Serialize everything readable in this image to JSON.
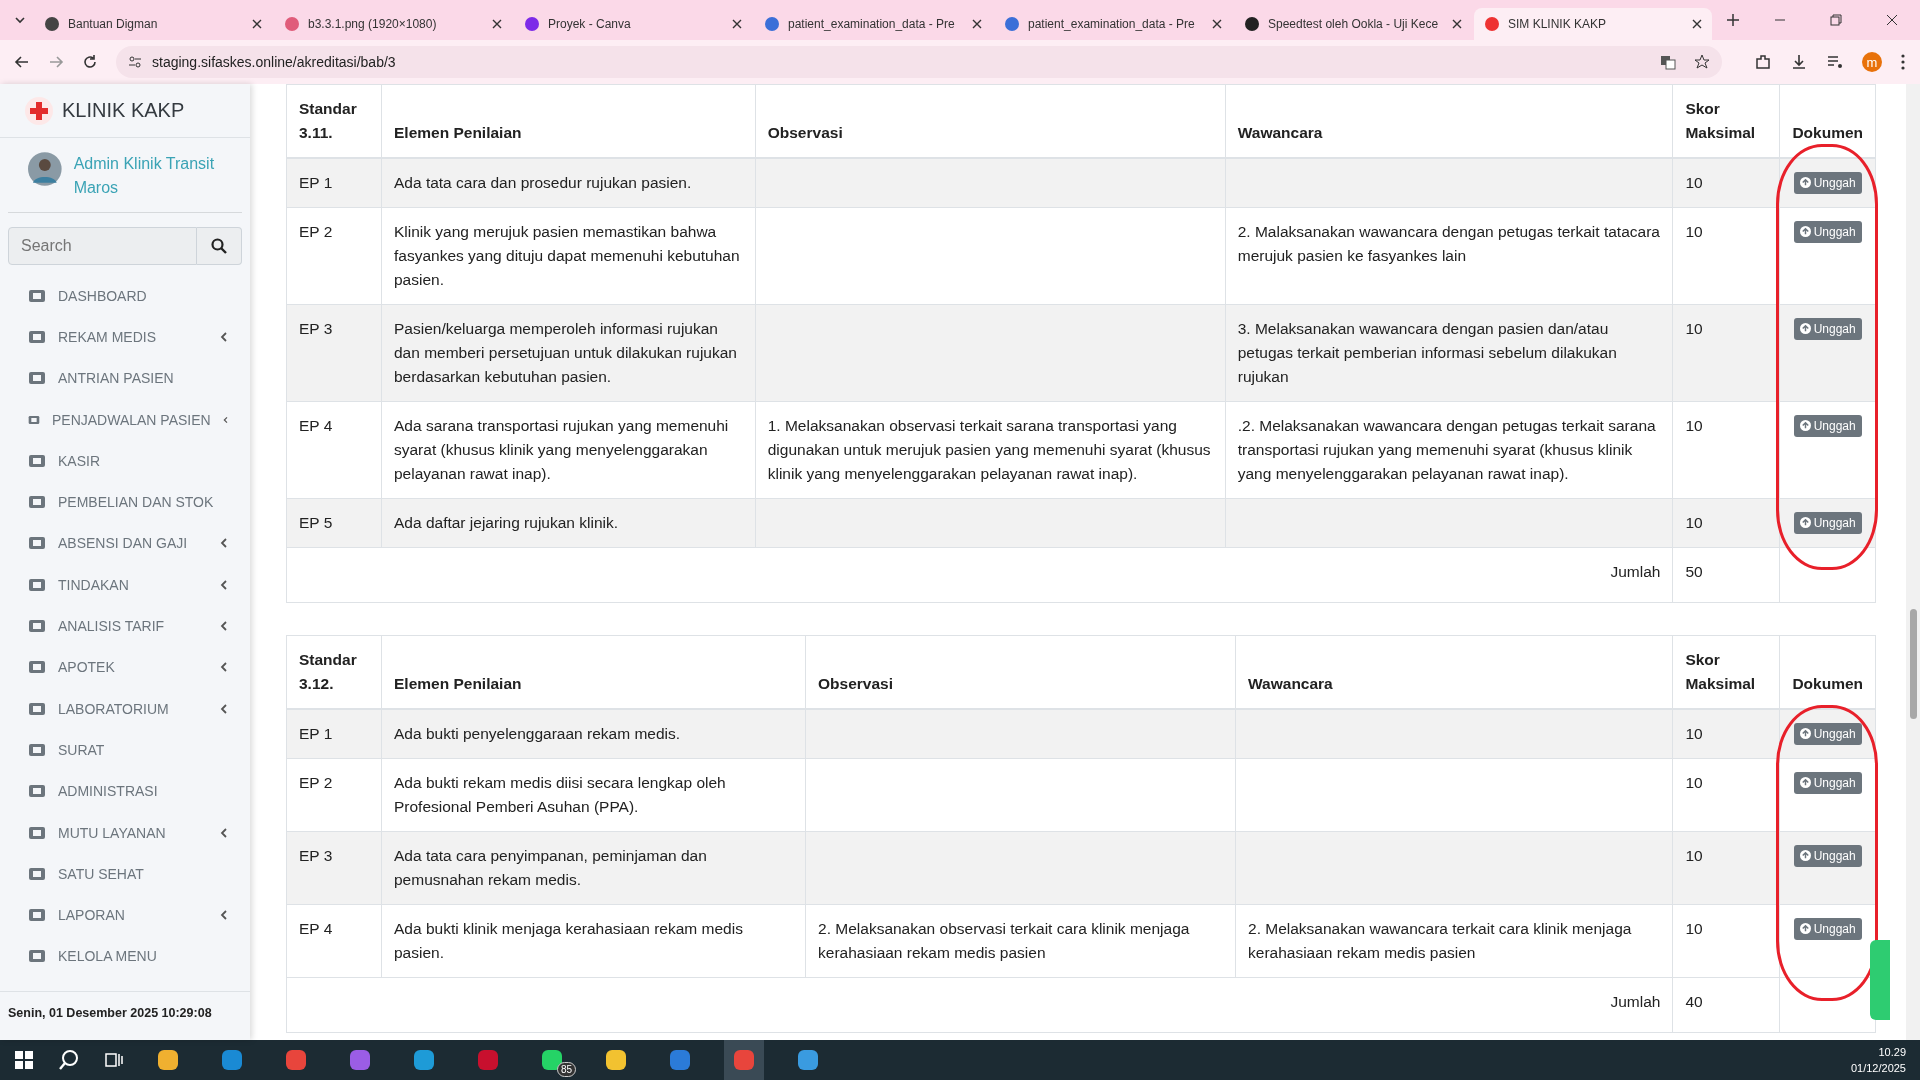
{
  "browser": {
    "tabs": [
      {
        "title": "Bantuan Digman",
        "selected": false
      },
      {
        "title": "b3.3.1.png (1920×1080)",
        "selected": false
      },
      {
        "title": "Proyek - Canva",
        "selected": false
      },
      {
        "title": "patient_examination_data - Pre",
        "selected": false
      },
      {
        "title": "patient_examination_data - Pre",
        "selected": false
      },
      {
        "title": "Speedtest oleh Ookla - Uji Kece",
        "selected": false
      },
      {
        "title": "SIM KLINIK KAKP",
        "selected": true
      }
    ],
    "address": "staging.sifaskes.online/akreditasi/bab/3",
    "profile": "m"
  },
  "sidebar": {
    "brand": "KLINIK KAKP",
    "user": "Admin Klinik Transit Maros",
    "search": {
      "placeholder": "Search"
    },
    "items": [
      {
        "label": "DASHBOARD",
        "submenu": false
      },
      {
        "label": "REKAM MEDIS",
        "submenu": true
      },
      {
        "label": "ANTRIAN PASIEN",
        "submenu": false
      },
      {
        "label": "PENJADWALAN PASIEN",
        "submenu": true
      },
      {
        "label": "KASIR",
        "submenu": false
      },
      {
        "label": "PEMBELIAN DAN STOK",
        "submenu": false
      },
      {
        "label": "ABSENSI DAN GAJI",
        "submenu": true
      },
      {
        "label": "TINDAKAN",
        "submenu": true
      },
      {
        "label": "ANALISIS TARIF",
        "submenu": true
      },
      {
        "label": "APOTEK",
        "submenu": true
      },
      {
        "label": "LABORATORIUM",
        "submenu": true
      },
      {
        "label": "SURAT",
        "submenu": false
      },
      {
        "label": "ADMINISTRASI",
        "submenu": false
      },
      {
        "label": "MUTU LAYANAN",
        "submenu": true
      },
      {
        "label": "SATU SEHAT",
        "submenu": false
      },
      {
        "label": "LAPORAN",
        "submenu": true
      },
      {
        "label": "KELOLA MENU",
        "submenu": false
      }
    ],
    "datetime": "Senin, 01 Desember 2025 10:29:08"
  },
  "tables": [
    {
      "headers": [
        "Standar 3.11.",
        "Elemen Penilaian",
        "Observasi",
        "Wawancara",
        "Skor Maksimal",
        "Dokumen"
      ],
      "rows": [
        {
          "ep": "EP 1",
          "elemen": "Ada tata cara dan prosedur rujukan pasien.",
          "observasi": "",
          "wawancara": "",
          "skor": "10",
          "button": "Unggah"
        },
        {
          "ep": "EP 2",
          "elemen": "Klinik yang merujuk pasien memastikan bahwa fasyankes yang dituju dapat memenuhi kebutuhan pasien.",
          "observasi": "",
          "wawancara": "2. Malaksanakan wawancara dengan petugas terkait tatacara merujuk pasien ke fasyankes lain",
          "skor": "10",
          "button": "Unggah"
        },
        {
          "ep": "EP 3",
          "elemen": "Pasien/keluarga memperoleh informasi rujukan dan memberi persetujuan untuk dilakukan rujukan berdasarkan kebutuhan pasien.",
          "observasi": "",
          "wawancara": "3. Melaksanakan wawancara dengan pasien dan/atau petugas terkait pemberian informasi sebelum dilakukan rujukan",
          "skor": "10",
          "button": "Unggah"
        },
        {
          "ep": "EP 4",
          "elemen": "Ada sarana transportasi rujukan yang memenuhi syarat (khusus klinik yang menyelenggarakan pelayanan rawat inap).",
          "observasi": "1. Melaksanakan observasi terkait sarana transportasi yang digunakan untuk merujuk pasien yang memenuhi syarat (khusus klinik yang menyelenggarakan pelayanan rawat inap).",
          "wawancara": ".2. Melaksanakan wawancara dengan petugas terkait sarana transportasi rujukan yang memenuhi syarat (khusus klinik yang menyelenggarakan pelayanan rawat inap).",
          "skor": "10",
          "button": "Unggah"
        },
        {
          "ep": "EP 5",
          "elemen": "Ada daftar jejaring rujukan klinik.",
          "observasi": "",
          "wawancara": "",
          "skor": "10",
          "button": "Unggah"
        }
      ],
      "total_label": "Jumlah",
      "total": "50"
    },
    {
      "headers": [
        "Standar 3.12.",
        "Elemen Penilaian",
        "Observasi",
        "Wawancara",
        "Skor Maksimal",
        "Dokumen"
      ],
      "rows": [
        {
          "ep": "EP 1",
          "elemen": "Ada bukti penyelenggaraan rekam medis.",
          "observasi": "",
          "wawancara": "",
          "skor": "10",
          "button": "Unggah"
        },
        {
          "ep": "EP 2",
          "elemen": "Ada bukti rekam medis diisi secara lengkap oleh Profesional Pemberi Asuhan (PPA).",
          "observasi": "",
          "wawancara": "",
          "skor": "10",
          "button": "Unggah"
        },
        {
          "ep": "EP 3",
          "elemen": "Ada tata cara penyimpanan, peminjaman dan pemusnahan rekam medis.",
          "observasi": "",
          "wawancara": "",
          "skor": "10",
          "button": "Unggah"
        },
        {
          "ep": "EP 4",
          "elemen": "Ada bukti klinik menjaga kerahasiaan rekam medis pasien.",
          "observasi": "2. Melaksanakan observasi terkait cara klinik menjaga kerahasiaan rekam medis pasien",
          "wawancara": "2. Melaksanakan wawancara terkait cara klinik menjaga kerahasiaan rekam medis pasien",
          "skor": "10",
          "button": "Unggah"
        }
      ],
      "total_label": "Jumlah",
      "total": "40"
    }
  ],
  "taskbar": {
    "whatsapp_badge": "85",
    "time": "10.29",
    "date": "01/12/2025"
  }
}
